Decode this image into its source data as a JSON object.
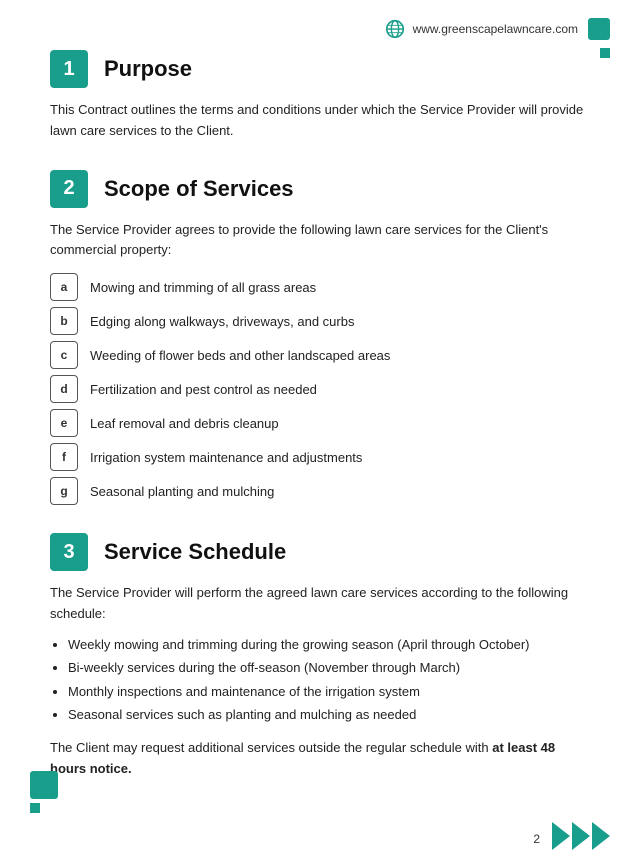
{
  "header": {
    "website": "www.greenscapelawncare.com"
  },
  "sections": [
    {
      "number": "1",
      "title": "Purpose",
      "body": "This Contract outlines the terms and conditions under which the Service Provider will provide lawn care services to the Client."
    },
    {
      "number": "2",
      "title": "Scope of Services",
      "intro": "The Service Provider agrees to provide the following lawn care services for the Client's commercial property:",
      "services": [
        {
          "letter": "a",
          "text": "Mowing and trimming of all grass areas"
        },
        {
          "letter": "b",
          "text": "Edging along walkways, driveways, and curbs"
        },
        {
          "letter": "c",
          "text": "Weeding of flower beds and other landscaped areas"
        },
        {
          "letter": "d",
          "text": "Fertilization and pest control as needed"
        },
        {
          "letter": "e",
          "text": "Leaf removal and debris cleanup"
        },
        {
          "letter": "f",
          "text": "Irrigation system maintenance and adjustments"
        },
        {
          "letter": "g",
          "text": "Seasonal planting and mulching"
        }
      ]
    },
    {
      "number": "3",
      "title": "Service Schedule",
      "intro": "The Service Provider will perform the agreed lawn care services according to the following schedule:",
      "bullets": [
        "Weekly mowing and trimming during the growing season (April through October)",
        "Bi-weekly services during the off-season (November through March)",
        "Monthly inspections and maintenance of the irrigation system",
        "Seasonal services such as planting and mulching as needed"
      ],
      "notice_prefix": "The Client may request additional services outside the regular schedule with ",
      "notice_bold": "at least 48 hours notice.",
      "notice_suffix": ""
    }
  ],
  "page_number": "2"
}
